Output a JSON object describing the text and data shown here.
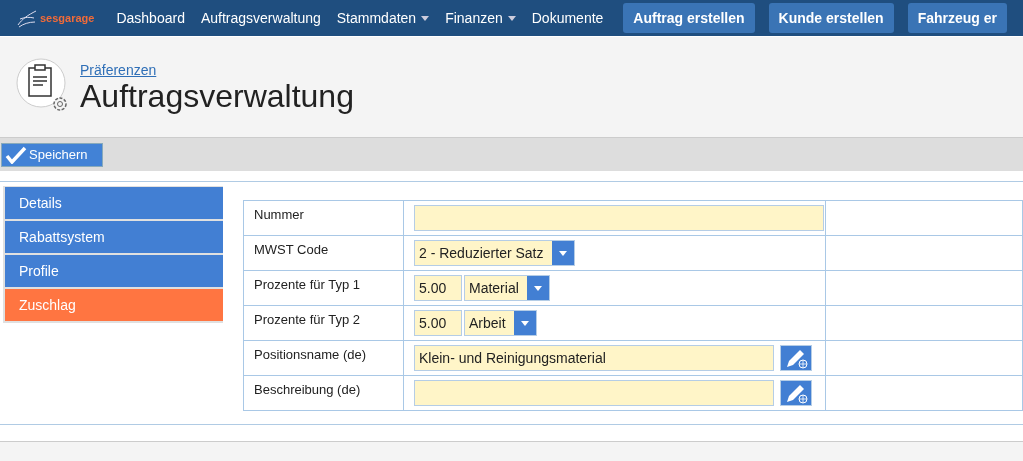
{
  "navbar": {
    "logo": "sesgarage",
    "items": [
      {
        "label": "Dashboard",
        "dropdown": false
      },
      {
        "label": "Auftragsverwaltung",
        "dropdown": false
      },
      {
        "label": "Stammdaten",
        "dropdown": true
      },
      {
        "label": "Finanzen",
        "dropdown": true
      },
      {
        "label": "Dokumente",
        "dropdown": false
      }
    ],
    "buttons": [
      "Auftrag erstellen",
      "Kunde erstellen",
      "Fahrzeug er"
    ]
  },
  "header": {
    "breadcrumb": "Präferenzen",
    "title": "Auftragsverwaltung"
  },
  "toolbar": {
    "save_button": "Speichern"
  },
  "sidebar": {
    "items": [
      {
        "label": "Details",
        "selected": false
      },
      {
        "label": "Rabattsystem",
        "selected": false
      },
      {
        "label": "Profile",
        "selected": false
      },
      {
        "label": "Zuschlag",
        "selected": true
      }
    ]
  },
  "form": {
    "rows": [
      {
        "kind": "text",
        "label": "Nummer",
        "value": ""
      },
      {
        "kind": "select",
        "label": "MWST Code",
        "value": "2 - Reduzierter Satz"
      },
      {
        "kind": "percent",
        "label": "Prozente für Typ 1",
        "value": "5.00",
        "option": "Material"
      },
      {
        "kind": "percent",
        "label": "Prozente für Typ 2",
        "value": "5.00",
        "option": "Arbeit"
      },
      {
        "kind": "translatable",
        "label": "Positionsname (de)",
        "value": "Klein- und Reinigungsmaterial"
      },
      {
        "kind": "translatable",
        "label": "Beschreibung (de)",
        "value": ""
      }
    ]
  }
}
